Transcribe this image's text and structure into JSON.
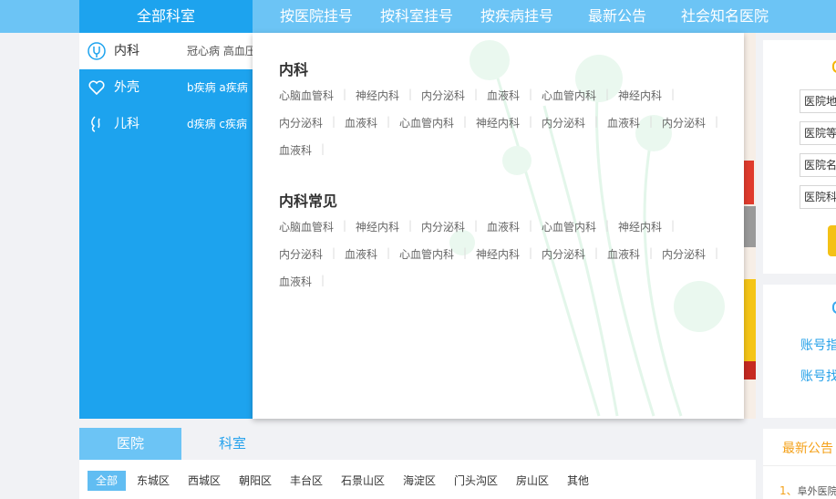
{
  "topnav": {
    "all_departments": "全部科室",
    "items": [
      "按医院挂号",
      "按科室挂号",
      "按疾病挂号",
      "最新公告",
      "社会知名医院"
    ]
  },
  "dept_menu": [
    {
      "name": "内科",
      "tags": "冠心病 高血压",
      "icon": "stethoscope-icon"
    },
    {
      "name": "外壳",
      "tags": "b疾病 a疾病",
      "icon": "heart-icon"
    },
    {
      "name": "儿科",
      "tags": "d疾病 c疾病",
      "icon": "child-icon"
    }
  ],
  "popup": {
    "sections": [
      {
        "title": "内科",
        "rows": [
          [
            "心脑血管科",
            "神经内科",
            "内分泌科",
            "血液科",
            "心血管内科",
            "神经内科"
          ],
          [
            "内分泌科",
            "血液科",
            "心血管内科",
            "神经内科",
            "内分泌科",
            "血液科",
            "内分泌科"
          ],
          [
            "血液科"
          ]
        ]
      },
      {
        "title": "内科常见",
        "rows": [
          [
            "心脑血管科",
            "神经内科",
            "内分泌科",
            "血液科",
            "心血管内科",
            "神经内科"
          ],
          [
            "内分泌科",
            "血液科",
            "心血管内科",
            "神经内科",
            "内分泌科",
            "血液科",
            "内分泌科"
          ],
          [
            "血液科"
          ]
        ]
      }
    ]
  },
  "right_panel": {
    "fields": [
      "医院地",
      "医院等",
      "医院名",
      "医院科"
    ],
    "account_links": [
      "账号指",
      "账号找"
    ]
  },
  "hospital_panel": {
    "tabs": [
      "医院",
      "科室"
    ],
    "districts": [
      "全部",
      "东城区",
      "西城区",
      "朝阳区",
      "丰台区",
      "石景山区",
      "海淀区",
      "门头沟区",
      "房山区",
      "其他"
    ]
  },
  "news": {
    "title": "最新公告",
    "first_item_number": "1、",
    "first_item_text": "阜外医院"
  },
  "colors": {
    "nav_bg": "#6cc4f5",
    "menu_bg": "#1da3ee",
    "accent_yellow": "#f4c116",
    "link_blue": "#26a1e8"
  }
}
